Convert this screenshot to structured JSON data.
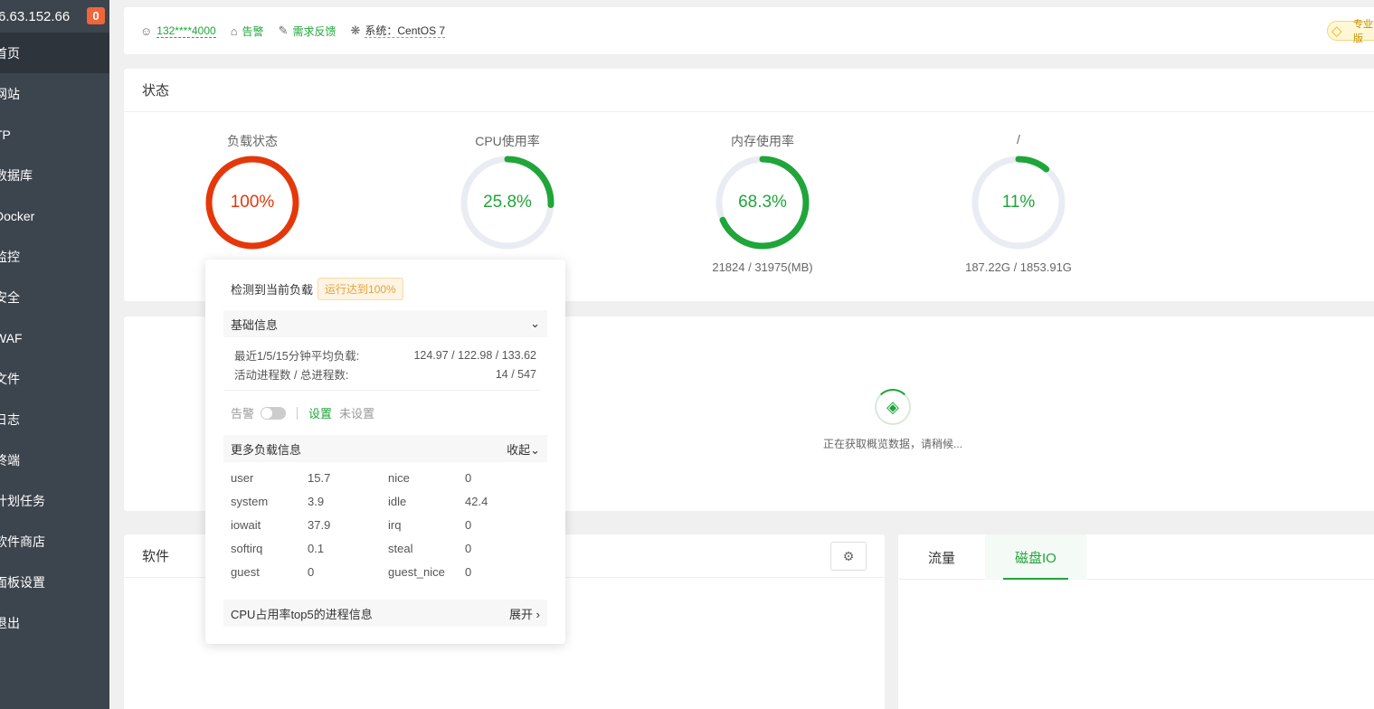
{
  "sidebar": {
    "ip": "6.63.152.66",
    "badge": "0",
    "items": [
      {
        "label": "首页",
        "active": true
      },
      {
        "label": "网站"
      },
      {
        "label": "TP"
      },
      {
        "label": "数据库"
      },
      {
        "label": "Docker"
      },
      {
        "label": "监控"
      },
      {
        "label": "安全"
      },
      {
        "label": "WAF"
      },
      {
        "label": "文件"
      },
      {
        "label": "日志"
      },
      {
        "label": "终端"
      },
      {
        "label": "计划任务"
      },
      {
        "label": "软件商店"
      },
      {
        "label": "面板设置"
      },
      {
        "label": "退出"
      }
    ]
  },
  "topbar": {
    "user": "132****4000",
    "alarm": "告警",
    "feedback": "需求反馈",
    "system": "系统：CentOS 7",
    "vip": "专业版"
  },
  "status": {
    "title": "状态",
    "gauges": [
      {
        "label": "负载状态",
        "value": "100%",
        "percent": 100,
        "color": "#e5380a",
        "sub": ""
      },
      {
        "label": "CPU使用率",
        "value": "25.8%",
        "percent": 25.8,
        "color": "#20a53a",
        "sub": ""
      },
      {
        "label": "内存使用率",
        "value": "68.3%",
        "percent": 68.3,
        "color": "#20a53a",
        "sub": "21824 / 31975(MB)"
      },
      {
        "label": "/",
        "value": "11%",
        "percent": 11,
        "color": "#20a53a",
        "sub": "187.22G / 1853.91G"
      }
    ]
  },
  "overview": {
    "loading_text": "正在获取概览数据，请稍候..."
  },
  "software": {
    "title": "软件"
  },
  "io": {
    "tabs": [
      "流量",
      "磁盘IO"
    ],
    "active": 1
  },
  "popup": {
    "title": "检测到当前负载",
    "tag": "运行达到100%",
    "basic_title": "基础信息",
    "load_label": "最近1/5/15分钟平均负载:",
    "load_value": "124.97 / 122.98 / 133.62",
    "proc_label": "活动进程数 / 总进程数:",
    "proc_value": "14 / 547",
    "alarm_label": "告警",
    "set_label": "设置",
    "unset_label": "未设置",
    "more_title": "更多负载信息",
    "collapse_label": "收起",
    "stats": [
      [
        "user",
        "15.7",
        "nice",
        "0"
      ],
      [
        "system",
        "3.9",
        "idle",
        "42.4"
      ],
      [
        "iowait",
        "37.9",
        "irq",
        "0"
      ],
      [
        "softirq",
        "0.1",
        "steal",
        "0"
      ],
      [
        "guest",
        "0",
        "guest_nice",
        "0"
      ]
    ],
    "top5_title": "CPU占用率top5的进程信息",
    "expand_label": "展开"
  }
}
